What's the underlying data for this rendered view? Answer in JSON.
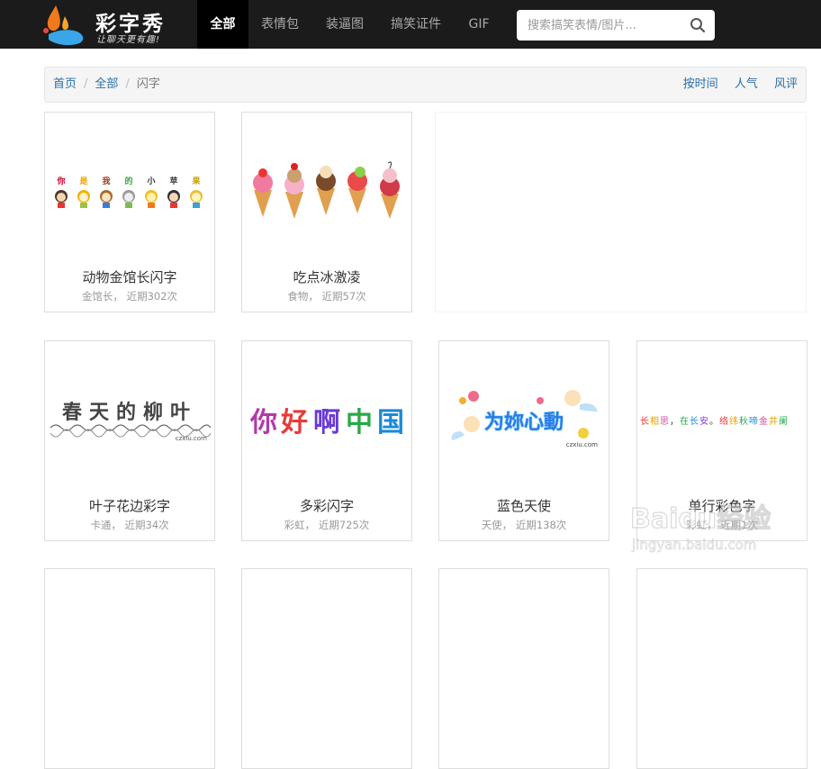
{
  "logo": {
    "title": "彩字秀",
    "slogan": "让聊天更有趣!"
  },
  "nav": [
    {
      "label": "全部",
      "active": true
    },
    {
      "label": "表情包"
    },
    {
      "label": "装逼图"
    },
    {
      "label": "搞笑证件"
    },
    {
      "label": "GIF"
    }
  ],
  "search": {
    "placeholder": "搜索搞笑表情/图片..."
  },
  "breadcrumb": {
    "home": "首页",
    "sep": "/",
    "all": "全部",
    "current": "闪字"
  },
  "sorts": [
    "按时间",
    "人气",
    "风评"
  ],
  "cards": [
    {
      "title": "动物金馆长闪字",
      "meta": "金馆长， 近期302次",
      "thumb_text": [
        "你",
        "是",
        "我",
        "的",
        "小",
        "苹",
        "果"
      ]
    },
    {
      "title": "吃点冰激凌",
      "meta": "食物， 近期57次"
    },
    {
      "title": "叶子花边彩字",
      "meta": "卡通， 近期34次",
      "thumb_text": "春天的柳叶",
      "thumb_sub": "czxiu.com"
    },
    {
      "title": "多彩闪字",
      "meta": "彩虹， 近期725次",
      "thumb_text": [
        "你",
        "好",
        "啊",
        "中",
        "国"
      ]
    },
    {
      "title": "蓝色天使",
      "meta": "天使， 近期138次",
      "thumb_text": "为妳心動",
      "thumb_sub": "czxiu.com"
    },
    {
      "title": "单行彩色字",
      "meta": "彩虹， 近期1次",
      "thumb_text": [
        "长",
        "相",
        "思",
        "，",
        "在",
        "长",
        "安",
        "。",
        "络",
        "纬",
        "秋",
        "啼",
        "金",
        "井",
        "阑"
      ]
    }
  ],
  "watermark": {
    "brand": "Baidu经验",
    "url": "jingyan.baidu.com"
  },
  "colors": {
    "link": "#2a6fa8",
    "topbar": "#1b1b1b"
  }
}
